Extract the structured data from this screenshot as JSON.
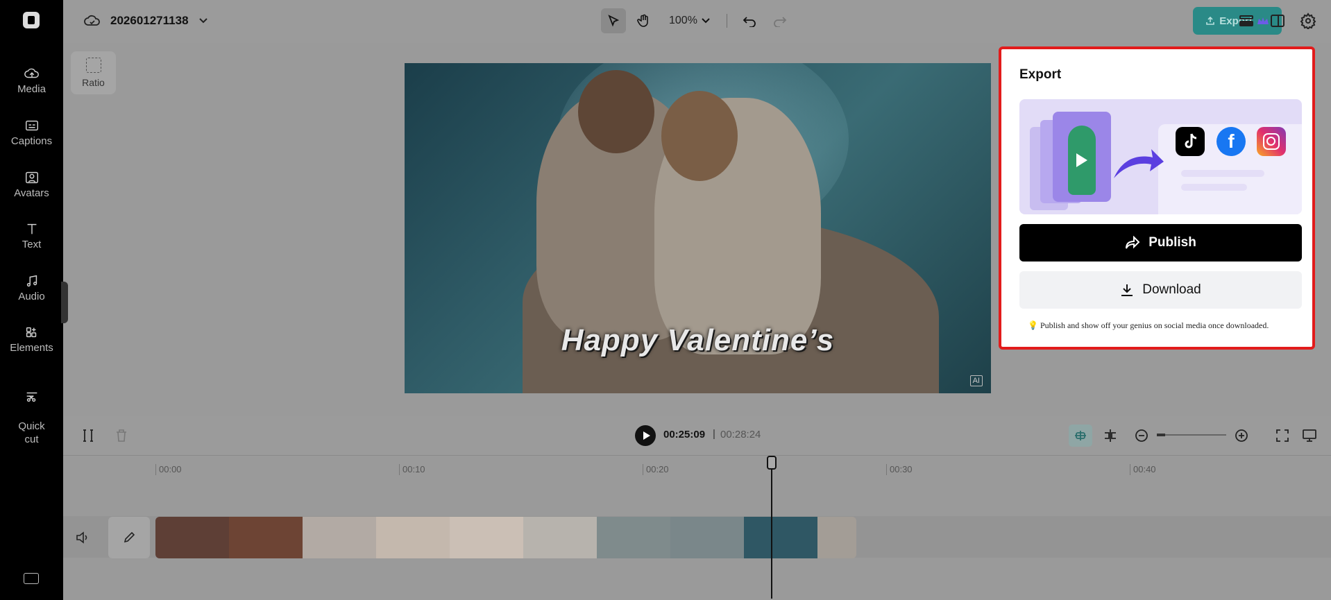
{
  "sidebar": {
    "items": [
      {
        "label": "Media",
        "icon": "cloud-upload-icon"
      },
      {
        "label": "Captions",
        "icon": "captions-icon"
      },
      {
        "label": "Avatars",
        "icon": "avatar-icon"
      },
      {
        "label": "Text",
        "icon": "text-icon"
      },
      {
        "label": "Audio",
        "icon": "music-note-icon"
      },
      {
        "label": "Elements",
        "icon": "elements-icon"
      },
      {
        "label": "Quick\ncut",
        "icon": "scissors-icon"
      }
    ]
  },
  "header": {
    "project_name": "202601271138",
    "zoom": "100%",
    "export_label": "Export"
  },
  "canvas": {
    "ratio_label": "Ratio",
    "caption_text": "Happy Valentine’s",
    "ai_badge": "AI"
  },
  "export_panel": {
    "title": "Export",
    "publish_label": "Publish",
    "download_label": "Download",
    "tip": "Publish and show off your genius on social media once downloaded.",
    "social_icons": [
      "tiktok-icon",
      "facebook-icon",
      "instagram-icon"
    ],
    "border_color": "#e21b1b"
  },
  "timeline": {
    "current_time": "00:25:09",
    "divider": "|",
    "total_time": "00:28:24",
    "ruler_labels": [
      "00:00",
      "00:10",
      "00:20",
      "00:30",
      "00:40"
    ]
  },
  "colors": {
    "accent": "#2a8a87",
    "publish_bg": "#000000"
  }
}
